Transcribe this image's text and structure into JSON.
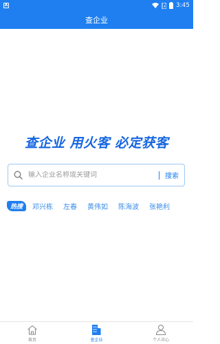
{
  "status_bar": {
    "notification_glyph": "A",
    "time": "3:45",
    "icons": [
      "wifi-icon",
      "sim-icon",
      "battery-icon"
    ]
  },
  "header": {
    "title": "查企业"
  },
  "slogan": "查企业 用火客 必定获客",
  "search": {
    "placeholder": "输入企业名称或关键词",
    "value": "",
    "button_label": "搜索"
  },
  "hot_search": {
    "badge_label": "热搜",
    "items": [
      "邓兴栋",
      "左春",
      "黄伟如",
      "陈海波",
      "张艳利"
    ]
  },
  "tab_bar": {
    "tabs": [
      {
        "label": "首页",
        "icon": "home-icon",
        "active": false
      },
      {
        "label": "查企业",
        "icon": "building-icon",
        "active": true
      },
      {
        "label": "个人中心",
        "icon": "user-icon",
        "active": false
      }
    ]
  },
  "colors": {
    "brand": "#1f7ff0",
    "slogan": "#1565e0",
    "hot_item": "#3b8cea",
    "inactive_tab": "#888888"
  }
}
